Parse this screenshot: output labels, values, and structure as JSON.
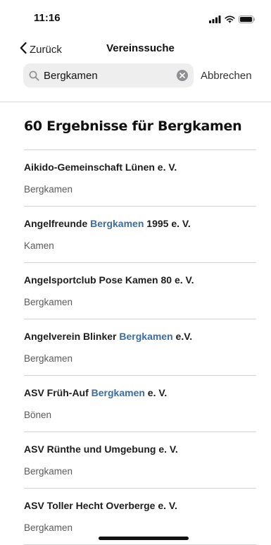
{
  "status": {
    "time": "11:16",
    "icons": [
      "cellular-signal-icon",
      "wifi-icon",
      "battery-icon"
    ]
  },
  "nav": {
    "back_label": "Zurück",
    "title": "Vereinssuche"
  },
  "search": {
    "value": "Bergkamen",
    "cancel_label": "Abbrechen"
  },
  "results": {
    "heading": "60 Ergebnisse für Bergkamen",
    "highlight_color": "#3a6da3",
    "items": [
      {
        "name_before": "Aikido-Gemeinschaft Lünen e. V.",
        "name_highlight": "",
        "name_after": "",
        "city": "Bergkamen"
      },
      {
        "name_before": "Angelfreunde ",
        "name_highlight": "Bergkamen",
        "name_after": " 1995 e. V.",
        "city": "Kamen"
      },
      {
        "name_before": "Angelsportclub Pose Kamen 80 e. V.",
        "name_highlight": "",
        "name_after": "",
        "city": "Bergkamen"
      },
      {
        "name_before": "Angelverein Blinker ",
        "name_highlight": "Bergkamen",
        "name_after": " e.V.",
        "city": "Bergkamen"
      },
      {
        "name_before": "ASV Früh-Auf ",
        "name_highlight": "Bergkamen",
        "name_after": " e. V.",
        "city": "Bönen"
      },
      {
        "name_before": "ASV Rünthe und Umgebung e. V.",
        "name_highlight": "",
        "name_after": "",
        "city": "Bergkamen"
      },
      {
        "name_before": "ASV Toller Hecht Overberge e. V.",
        "name_highlight": "",
        "name_after": "",
        "city": "Bergkamen"
      }
    ]
  }
}
